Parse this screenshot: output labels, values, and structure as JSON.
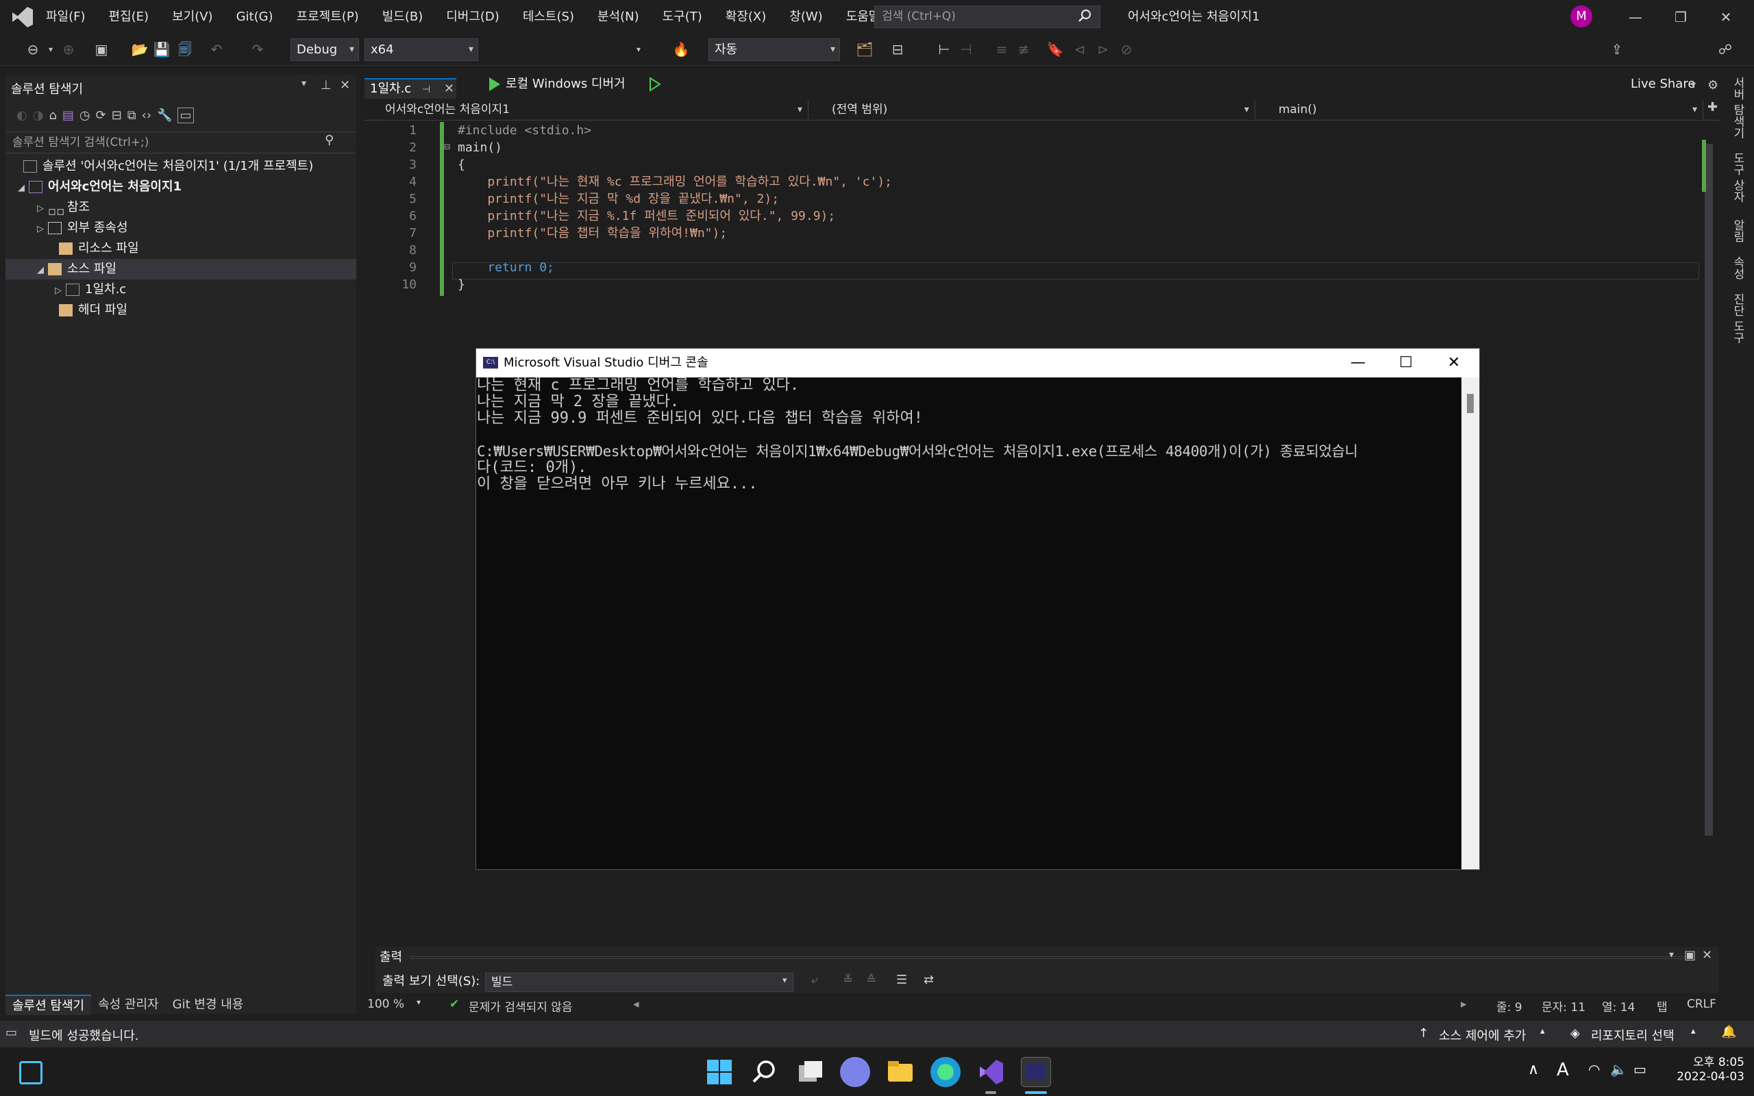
{
  "menu": [
    "파일(F)",
    "편집(E)",
    "보기(V)",
    "Git(G)",
    "프로젝트(P)",
    "빌드(B)",
    "디버그(D)",
    "테스트(S)",
    "분석(N)",
    "도구(T)",
    "확장(X)",
    "창(W)",
    "도움말(H)"
  ],
  "search": {
    "placeholder": "검색 (Ctrl+Q)"
  },
  "solution_name": "어서와c언어는 처음이지1",
  "avatar_letter": "M",
  "toolbar": {
    "config": "Debug",
    "platform": "x64",
    "run_label": "로컬 Windows 디버거",
    "auto": "자동",
    "live_share": "Live Share"
  },
  "solution_explorer": {
    "title": "솔루션 탐색기",
    "search_placeholder": "솔루션 탐색기 검색(Ctrl+;)",
    "tree": [
      "솔루션 '어서와c언어는 처음이지1' (1/1개 프로젝트)",
      "어서와c언어는 처음이지1",
      "참조",
      "외부 종속성",
      "리소스 파일",
      "소스 파일",
      "1일차.c",
      "헤더 파일"
    ],
    "bottom_tabs": [
      "솔루션 탐색기",
      "속성 관리자",
      "Git 변경 내용"
    ]
  },
  "editor": {
    "tab": "1일차.c",
    "nav_project": "어서와c언어는 처음이지1",
    "nav_scope": "(전역 범위)",
    "nav_func": "main()",
    "line_numbers": [
      "1",
      "2",
      "3",
      "4",
      "5",
      "6",
      "7",
      "8",
      "9",
      "10"
    ],
    "code": [
      "#include <stdio.h>",
      "main()",
      "{",
      "    printf(\"나는 현재 %c 프로그래밍 언어를 학습하고 있다.₩n\", 'c');",
      "    printf(\"나는 지금 막 %d 장을 끝냈다.₩n\", 2);",
      "    printf(\"나는 지금 %.1f 퍼센트 준비되어 있다.\", 99.9);",
      "    printf(\"다음 챕터 학습을 위하여!₩n\");",
      "",
      "    return 0;",
      "}"
    ]
  },
  "right_tabs": [
    "서버 탐색기",
    "도구 상자",
    "알림",
    "속성",
    "진단 도구"
  ],
  "console": {
    "title": "Microsoft Visual Studio 디버그 콘솔",
    "lines": [
      "나는 현재 c 프로그래밍 언어를 학습하고 있다.",
      "나는 지금 막 2 장을 끝냈다.",
      "나는 지금 99.9 퍼센트 준비되어 있다.다음 챕터 학습을 위하여!",
      "",
      "C:₩Users₩USER₩Desktop₩어서와c언어는 처음이지1₩x64₩Debug₩어서와c언어는 처음이지1.exe(프로세스 48400개)이(가) 종료되었습니",
      "다(코드: 0개).",
      "이 창을 닫으려면 아무 키나 누르세요..."
    ]
  },
  "output": {
    "title": "출력",
    "source_label": "출력 보기 선택(S):",
    "source_value": "빌드"
  },
  "editor_status": {
    "zoom": "100 %",
    "issues": "문제가 검색되지 않음",
    "line": "줄: 9",
    "char": "문자: 11",
    "col": "열: 14",
    "tab": "탭",
    "eol": "CRLF"
  },
  "status": {
    "message": "빌드에 성공했습니다.",
    "source_control": "소스 제어에 추가",
    "repo": "리포지토리 선택"
  },
  "clock": {
    "time": "오후 8:05",
    "date": "2022-04-03"
  },
  "colors": {
    "accent": "#0e70c0",
    "run_green": "#4ec94e",
    "keyword": "#569cd6",
    "string": "#d69d85",
    "preproc": "#9b9b9b",
    "number": "#b5cea8",
    "change_bar": "#57a64a"
  }
}
